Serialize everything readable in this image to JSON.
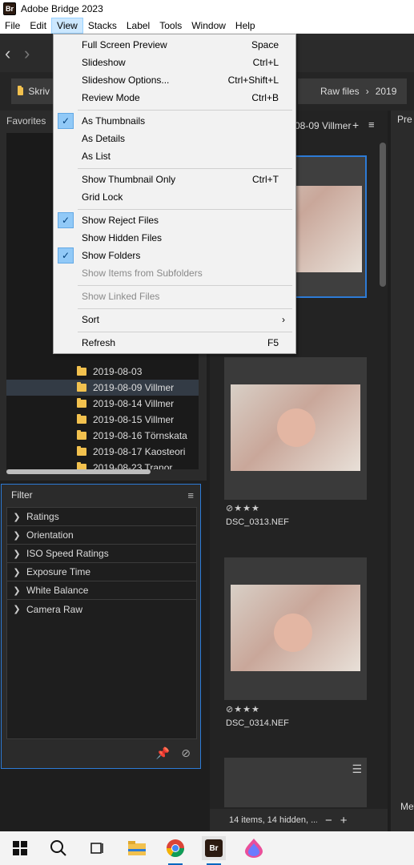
{
  "app": {
    "logo": "Br",
    "title": "Adobe Bridge 2023"
  },
  "menubar": [
    "File",
    "Edit",
    "View",
    "Stacks",
    "Label",
    "Tools",
    "Window",
    "Help"
  ],
  "breadcrumb": {
    "first": "Skriv",
    "raw": "Raw files",
    "year": "2019"
  },
  "favorites_tab": "Favorites",
  "tree": {
    "rows": [
      "2019-08-03",
      "2019-08-09 Villmer",
      "2019-08-14 Villmer",
      "2019-08-15 Villmer",
      "2019-08-16 Törnskata",
      "2019-08-17 Kaosteori",
      "2019-08-23 Tranor"
    ],
    "selected_index": 1
  },
  "filter": {
    "title": "Filter",
    "items": [
      "Ratings",
      "Orientation",
      "ISO Speed Ratings",
      "Exposure Time",
      "White Balance",
      "Camera Raw"
    ]
  },
  "content": {
    "header": "08-09 Villmer",
    "thumbs": [
      {
        "stars": "⊘★★★",
        "name": "DSC_0313.NEF"
      },
      {
        "stars": "⊘★★★",
        "name": "DSC_0314.NEF"
      }
    ],
    "status": "14 items, 14 hidden, ...",
    "status_minus": "−",
    "status_plus": "+"
  },
  "right": {
    "top": "Pre",
    "bottom": "Met"
  },
  "view_menu": {
    "items": [
      {
        "label": "Full Screen Preview",
        "shortcut": "Space",
        "checked": false,
        "disabled": false
      },
      {
        "label": "Slideshow",
        "shortcut": "Ctrl+L",
        "checked": false,
        "disabled": false
      },
      {
        "label": "Slideshow Options...",
        "shortcut": "Ctrl+Shift+L",
        "checked": false,
        "disabled": false
      },
      {
        "label": "Review Mode",
        "shortcut": "Ctrl+B",
        "checked": false,
        "disabled": false
      },
      {
        "label": "As Thumbnails",
        "shortcut": "",
        "checked": true,
        "disabled": false
      },
      {
        "label": "As Details",
        "shortcut": "",
        "checked": false,
        "disabled": false
      },
      {
        "label": "As List",
        "shortcut": "",
        "checked": false,
        "disabled": false
      },
      {
        "label": "Show Thumbnail Only",
        "shortcut": "Ctrl+T",
        "checked": false,
        "disabled": false
      },
      {
        "label": "Grid Lock",
        "shortcut": "",
        "checked": false,
        "disabled": false
      },
      {
        "label": "Show Reject Files",
        "shortcut": "",
        "checked": true,
        "disabled": false
      },
      {
        "label": "Show Hidden Files",
        "shortcut": "",
        "checked": false,
        "disabled": false
      },
      {
        "label": "Show Folders",
        "shortcut": "",
        "checked": true,
        "disabled": false
      },
      {
        "label": "Show Items from Subfolders",
        "shortcut": "",
        "checked": false,
        "disabled": true
      },
      {
        "label": "Show Linked Files",
        "shortcut": "",
        "checked": false,
        "disabled": true
      },
      {
        "label": "Sort",
        "shortcut": "",
        "checked": false,
        "disabled": false,
        "submenu": true
      },
      {
        "label": "Refresh",
        "shortcut": "F5",
        "checked": false,
        "disabled": false
      }
    ],
    "check_glyph": "✓",
    "submenu_glyph": "›"
  },
  "colors": {
    "accent": "#2d7bd6",
    "menu_bg": "#f2f2f2",
    "check_bg": "#91c9f7"
  }
}
